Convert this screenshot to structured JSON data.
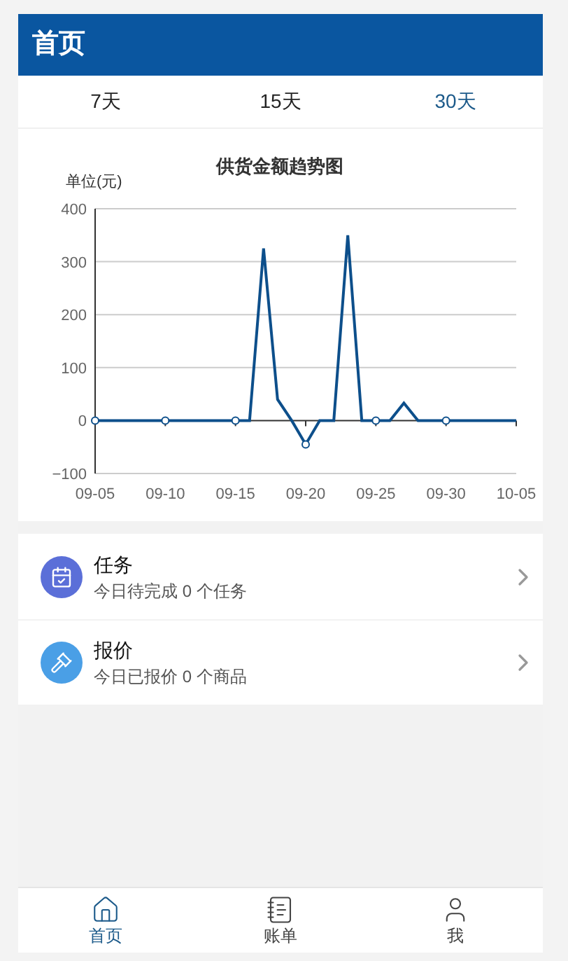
{
  "header": {
    "title": "首页"
  },
  "ranges": [
    {
      "label": "7天",
      "selected": false
    },
    {
      "label": "15天",
      "selected": false
    },
    {
      "label": "30天",
      "selected": true
    }
  ],
  "chart": {
    "chart_data": {
      "type": "line",
      "title": "供货金额趋势图",
      "ylabel": "单位(元)",
      "categories": [
        "09-05",
        null,
        null,
        null,
        null,
        "09-10",
        null,
        null,
        null,
        null,
        "09-15",
        null,
        null,
        null,
        null,
        "09-20",
        null,
        null,
        null,
        null,
        "09-25",
        null,
        null,
        null,
        null,
        "09-30",
        null,
        null,
        null,
        null,
        "10-05"
      ],
      "grid": true,
      "series": [
        {
          "color": "#0d4f8b",
          "values": [
            0,
            0,
            0,
            0,
            0,
            0,
            0,
            0,
            0,
            0,
            0,
            0,
            325,
            40,
            0,
            -45,
            0,
            0,
            350,
            0,
            0,
            0,
            33,
            0,
            0,
            0,
            0,
            0,
            0,
            0,
            0
          ]
        }
      ],
      "ylim": [
        -100,
        400
      ],
      "yticks": [
        -100,
        0,
        100,
        200,
        300,
        400
      ]
    }
  },
  "entries": [
    {
      "kind": "task",
      "title": "任务",
      "subtitle": "今日待完成 0 个任务",
      "color": "#5b6fd8"
    },
    {
      "kind": "quote",
      "title": "报价",
      "subtitle": "今日已报价 0 个商品",
      "color": "#4a9fe6"
    }
  ],
  "tabbar": [
    {
      "kind": "home",
      "label": "首页",
      "selected": true
    },
    {
      "kind": "bill",
      "label": "账单",
      "selected": false
    },
    {
      "kind": "me",
      "label": "我",
      "selected": false
    }
  ]
}
